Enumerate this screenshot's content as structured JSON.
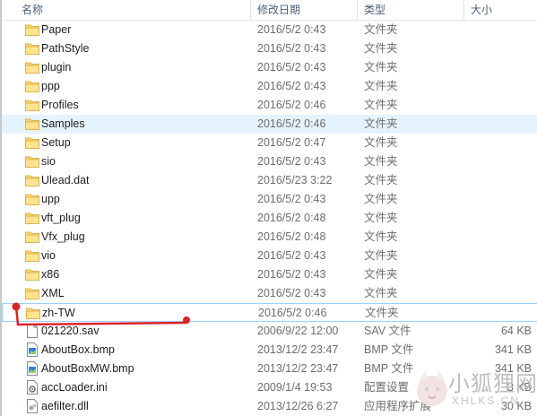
{
  "columns": {
    "name": "名称",
    "date": "修改日期",
    "type": "类型",
    "size": "大小"
  },
  "rows": [
    {
      "name": "Paper",
      "date": "2016/5/2 0:43",
      "type": "文件夹",
      "size": "",
      "icon": "folder-icon"
    },
    {
      "name": "PathStyle",
      "date": "2016/5/2 0:43",
      "type": "文件夹",
      "size": "",
      "icon": "folder-icon"
    },
    {
      "name": "plugin",
      "date": "2016/5/2 0:43",
      "type": "文件夹",
      "size": "",
      "icon": "folder-icon"
    },
    {
      "name": "ppp",
      "date": "2016/5/2 0:43",
      "type": "文件夹",
      "size": "",
      "icon": "folder-icon"
    },
    {
      "name": "Profiles",
      "date": "2016/5/2 0:46",
      "type": "文件夹",
      "size": "",
      "icon": "folder-icon"
    },
    {
      "name": "Samples",
      "date": "2016/5/2 0:46",
      "type": "文件夹",
      "size": "",
      "icon": "folder-icon",
      "state": "hover"
    },
    {
      "name": "Setup",
      "date": "2016/5/2 0:47",
      "type": "文件夹",
      "size": "",
      "icon": "folder-icon"
    },
    {
      "name": "sio",
      "date": "2016/5/2 0:43",
      "type": "文件夹",
      "size": "",
      "icon": "folder-icon"
    },
    {
      "name": "Ulead.dat",
      "date": "2016/5/23 3:22",
      "type": "文件夹",
      "size": "",
      "icon": "folder-icon"
    },
    {
      "name": "upp",
      "date": "2016/5/2 0:43",
      "type": "文件夹",
      "size": "",
      "icon": "folder-icon"
    },
    {
      "name": "vft_plug",
      "date": "2016/5/2 0:48",
      "type": "文件夹",
      "size": "",
      "icon": "folder-icon"
    },
    {
      "name": "Vfx_plug",
      "date": "2016/5/2 0:48",
      "type": "文件夹",
      "size": "",
      "icon": "folder-icon"
    },
    {
      "name": "vio",
      "date": "2016/5/2 0:43",
      "type": "文件夹",
      "size": "",
      "icon": "folder-icon"
    },
    {
      "name": "x86",
      "date": "2016/5/2 0:43",
      "type": "文件夹",
      "size": "",
      "icon": "folder-icon"
    },
    {
      "name": "XML",
      "date": "2016/5/2 0:43",
      "type": "文件夹",
      "size": "",
      "icon": "folder-icon"
    },
    {
      "name": "zh-TW",
      "date": "2016/5/2 0:46",
      "type": "文件夹",
      "size": "",
      "icon": "folder-icon",
      "state": "focused"
    },
    {
      "name": "021220.sav",
      "date": "2006/9/22 12:00",
      "type": "SAV 文件",
      "size": "64 KB",
      "icon": "blank-file-icon"
    },
    {
      "name": "AboutBox.bmp",
      "date": "2013/12/2 23:47",
      "type": "BMP 文件",
      "size": "341 KB",
      "icon": "image-file-icon"
    },
    {
      "name": "AboutBoxMW.bmp",
      "date": "2013/12/2 23:47",
      "type": "BMP 文件",
      "size": "341 KB",
      "icon": "image-file-icon"
    },
    {
      "name": "accLoader.ini",
      "date": "2009/1/4 19:53",
      "type": "配置设置",
      "size": "3 KB",
      "icon": "settings-file-icon"
    },
    {
      "name": "aefilter.dll",
      "date": "2013/12/26 6:27",
      "type": "应用程序扩展",
      "size": "30 KB",
      "icon": "dll-file-icon"
    }
  ],
  "watermark": {
    "text": "小狐狸网",
    "sub": "XHLKS.CN"
  },
  "colors": {
    "hover_bg": "#e5f3ff",
    "focus_border": "#99d1ff",
    "folder": "#f8d775",
    "annotation": "#d9232a"
  }
}
